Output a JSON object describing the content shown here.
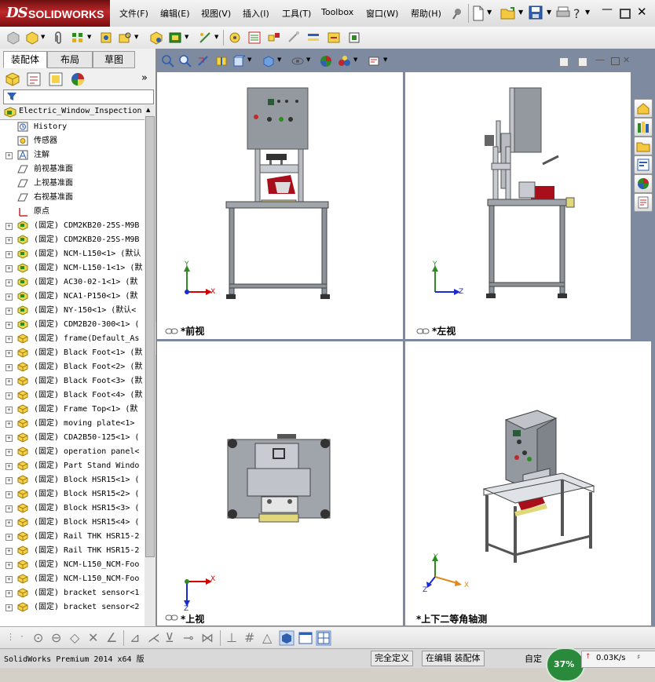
{
  "app": {
    "brand_prefix": "DS",
    "brand_name": "SOLIDWORKS"
  },
  "menu": [
    "文件(F)",
    "编辑(E)",
    "视图(V)",
    "插入(I)",
    "工具(T)",
    "Toolbox",
    "窗口(W)",
    "帮助(H)"
  ],
  "tabs": [
    "装配体",
    "布局",
    "草图"
  ],
  "tree": {
    "root": "Electric_Window_Inspection",
    "items": [
      {
        "label": "History",
        "icon": "history-icon",
        "expandable": false
      },
      {
        "label": "传感器",
        "icon": "sensor-icon",
        "expandable": false
      },
      {
        "label": "注解",
        "icon": "annotation-icon",
        "expandable": true
      },
      {
        "label": "前视基准面",
        "icon": "plane-icon",
        "expandable": false
      },
      {
        "label": "上视基准面",
        "icon": "plane-icon",
        "expandable": false
      },
      {
        "label": "右视基准面",
        "icon": "plane-icon",
        "expandable": false
      },
      {
        "label": "原点",
        "icon": "origin-icon",
        "expandable": false
      },
      {
        "label": "(固定) CDM2KB20-25S-M9B",
        "icon": "assembly-icon",
        "expandable": true
      },
      {
        "label": "(固定) CDM2KB20-25S-M9B",
        "icon": "assembly-icon",
        "expandable": true
      },
      {
        "label": "(固定) NCM-L150<1> (默认",
        "icon": "assembly-icon",
        "expandable": true
      },
      {
        "label": "(固定) NCM-L150-1<1> (默",
        "icon": "assembly-icon",
        "expandable": true
      },
      {
        "label": "(固定) AC30-02-1<1> (默",
        "icon": "assembly-icon",
        "expandable": true
      },
      {
        "label": "(固定) NCA1-P150<1> (默",
        "icon": "assembly-icon",
        "expandable": true
      },
      {
        "label": "(固定) NY-150<1> (默认<",
        "icon": "assembly-icon",
        "expandable": true
      },
      {
        "label": "(固定) CDM2B20-300<1> (",
        "icon": "assembly-icon",
        "expandable": true
      },
      {
        "label": "(固定) frame(Default_As",
        "icon": "part-icon",
        "expandable": true
      },
      {
        "label": "(固定) Black Foot<1> (默",
        "icon": "part-icon",
        "expandable": true
      },
      {
        "label": "(固定) Black Foot<2> (默",
        "icon": "part-icon",
        "expandable": true
      },
      {
        "label": "(固定) Black Foot<3> (默",
        "icon": "part-icon",
        "expandable": true
      },
      {
        "label": "(固定) Black Foot<4> (默",
        "icon": "part-icon",
        "expandable": true
      },
      {
        "label": "(固定) Frame Top<1> (默",
        "icon": "part-icon",
        "expandable": true
      },
      {
        "label": "(固定) moving plate<1>",
        "icon": "part-icon",
        "expandable": true
      },
      {
        "label": "(固定) CDA2B50-125<1> (",
        "icon": "part-icon",
        "expandable": true
      },
      {
        "label": "(固定) operation panel<",
        "icon": "part-icon",
        "expandable": true
      },
      {
        "label": "(固定) Part Stand Windo",
        "icon": "part-icon",
        "expandable": true
      },
      {
        "label": "(固定) Block HSR15<1> (",
        "icon": "part-icon",
        "expandable": true
      },
      {
        "label": "(固定) Block HSR15<2> (",
        "icon": "part-icon",
        "expandable": true
      },
      {
        "label": "(固定) Block HSR15<3> (",
        "icon": "part-icon",
        "expandable": true
      },
      {
        "label": "(固定) Block HSR15<4> (",
        "icon": "part-icon",
        "expandable": true
      },
      {
        "label": "(固定) Rail THK HSR15-2",
        "icon": "part-icon",
        "expandable": true
      },
      {
        "label": "(固定) Rail THK HSR15-2",
        "icon": "part-icon",
        "expandable": true
      },
      {
        "label": "(固定) NCM-L150_NCM-Foo",
        "icon": "part-icon",
        "expandable": true
      },
      {
        "label": "(固定) NCM-L150_NCM-Foo",
        "icon": "part-icon",
        "expandable": true
      },
      {
        "label": "(固定) bracket sensor<1",
        "icon": "part-icon",
        "expandable": true
      },
      {
        "label": "(固定) bracket sensor<2",
        "icon": "part-icon",
        "expandable": true
      }
    ]
  },
  "viewports": {
    "front": "*前视",
    "left": "*左视",
    "top": "*上视",
    "iso": "*上下二等角轴测"
  },
  "axes": {
    "x": "X",
    "y": "Y",
    "z": "Z"
  },
  "status": {
    "product": "SolidWorks Premium 2014 x64 版",
    "definition": "完全定义",
    "editing": "在编辑 装配体",
    "custom": "自定",
    "cpu_percent": "37%",
    "net_speed": "0.03K/s"
  },
  "colors": {
    "accent": "#c0282b",
    "axis_x": "#d40000",
    "axis_y": "#2e8b22",
    "axis_z": "#1a2bd6",
    "machine": "#8e9399"
  }
}
